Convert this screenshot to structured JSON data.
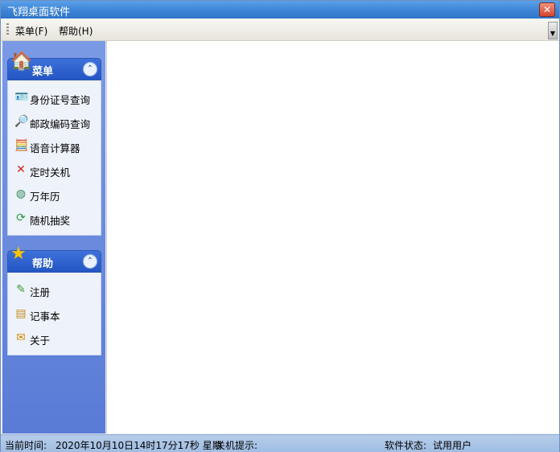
{
  "window": {
    "title": "飞翔桌面软件",
    "close_label": "✕"
  },
  "menubar": {
    "items": [
      "菜单(F)",
      "帮助(H)"
    ]
  },
  "sidebar": {
    "panels": [
      {
        "title": "菜单",
        "icon": "home-icon",
        "items": [
          {
            "label": "身份证号查询",
            "icon": "id-card-icon"
          },
          {
            "label": "邮政编码查询",
            "icon": "magnifier-icon"
          },
          {
            "label": "语音计算器",
            "icon": "calculator-icon"
          },
          {
            "label": "定时关机",
            "icon": "red-cross-icon"
          },
          {
            "label": "万年历",
            "icon": "calendar-icon"
          },
          {
            "label": "随机抽奖",
            "icon": "refresh-icon"
          }
        ]
      },
      {
        "title": "帮助",
        "icon": "star-icon",
        "items": [
          {
            "label": "注册",
            "icon": "register-icon"
          },
          {
            "label": "记事本",
            "icon": "notepad-icon"
          },
          {
            "label": "关于",
            "icon": "about-icon"
          }
        ]
      }
    ]
  },
  "statusbar": {
    "time_label": "当前时间:",
    "time_value": "2020年10月10日14时17分17秒 星期",
    "shutdown_label": "关机提示:",
    "state_label": "软件状态:",
    "state_value": "试用用户"
  },
  "colors": {
    "title_bar": "#3d84d6",
    "sidebar": "#6b8ce0",
    "panel_header": "#2a5bc8",
    "status_bar": "#a9c4e6"
  }
}
